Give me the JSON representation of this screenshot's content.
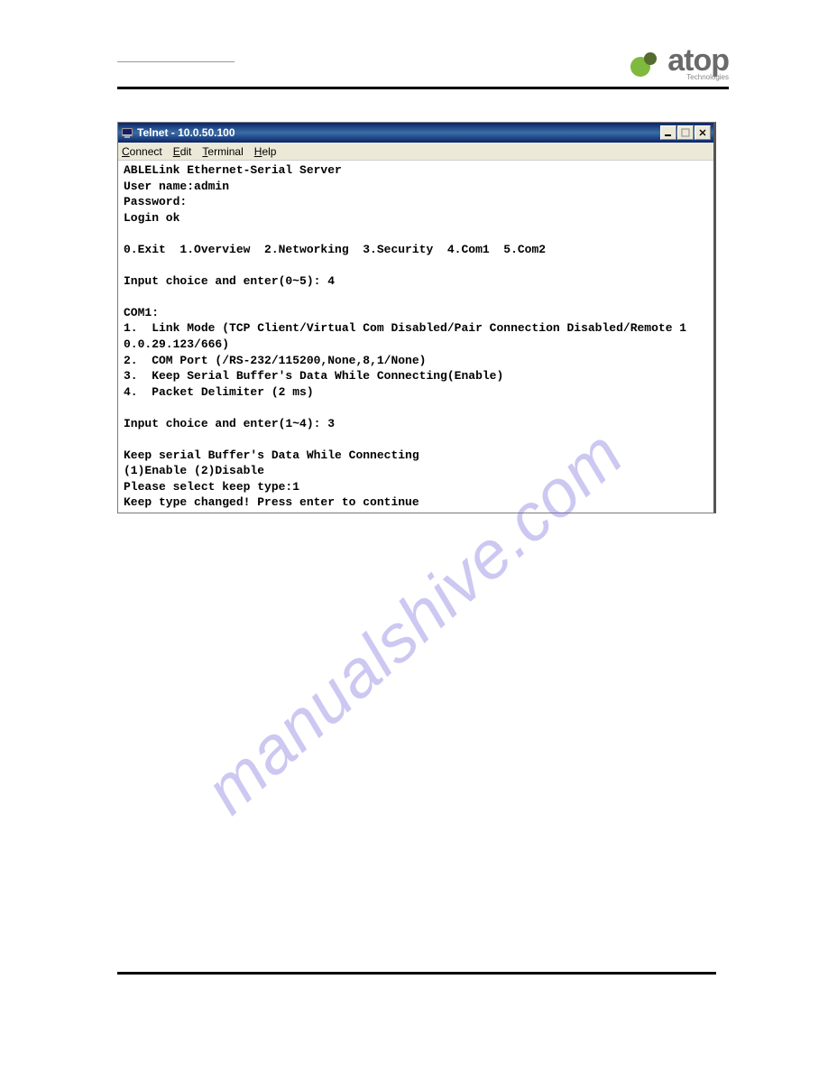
{
  "logo": {
    "brand": "atop",
    "tagline": "Technologies"
  },
  "window": {
    "title": "Telnet - 10.0.50.100"
  },
  "menu": {
    "connect": "Connect",
    "edit": "Edit",
    "terminal": "Terminal",
    "help": "Help"
  },
  "terminal": {
    "lines": [
      "ABLELink Ethernet-Serial Server",
      "User name:admin",
      "Password:",
      "Login ok",
      "",
      "0.Exit  1.Overview  2.Networking  3.Security  4.Com1  5.Com2",
      "",
      "Input choice and enter(0~5): 4",
      "",
      "COM1:",
      "1.  Link Mode (TCP Client/Virtual Com Disabled/Pair Connection Disabled/Remote 1",
      "0.0.29.123/666)",
      "2.  COM Port (/RS-232/115200,None,8,1/None)",
      "3.  Keep Serial Buffer's Data While Connecting(Enable)",
      "4.  Packet Delimiter (2 ms)",
      "",
      "Input choice and enter(1~4): 3",
      "",
      "Keep serial Buffer's Data While Connecting",
      "(1)Enable (2)Disable",
      "Please select keep type:1",
      "Keep type changed! Press enter to continue"
    ]
  },
  "watermark": "manualshive.com"
}
